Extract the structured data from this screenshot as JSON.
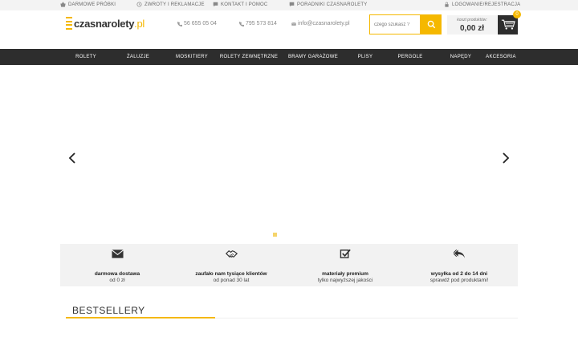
{
  "topbar": {
    "links": [
      "DARMOWE PRÓBKI",
      "ZWROTY I REKLAMACJE",
      "KONTAKT I POMOC",
      "PORADNIKI CZASNAROLETY"
    ],
    "login": "LOGOWANIE/REJESTRACJA"
  },
  "logo": {
    "brand": "czasnarolety",
    "tld": ".pl"
  },
  "contact": {
    "phone1": "56 655 05 04",
    "phone2": "795 573 814",
    "email": "info@czasnarolety.pl"
  },
  "search": {
    "placeholder": "czego szukasz ?"
  },
  "cart": {
    "label": "koszt produktów:",
    "total": "0,00 zł",
    "count": "0"
  },
  "nav": [
    "ROLETY",
    "ŻALUZJE",
    "MOSKITIERY",
    "ROLETY ZEWNĘTRZNE",
    "BRAMY GARAŻOWE",
    "PLISY",
    "PERGOLE",
    "NAPĘDY",
    "AKCESORIA"
  ],
  "features": [
    {
      "title": "darmowa dostawa",
      "subtitle": "od 0 zł",
      "icon": "envelope-icon"
    },
    {
      "title": "zaufało nam tysiące klientów",
      "subtitle": "od ponad 30 lat",
      "icon": "handshake-icon"
    },
    {
      "title": "materiały premium",
      "subtitle": "tylko najwyższej jakości",
      "icon": "checkbox-icon"
    },
    {
      "title": "wysyłka od 2 do 14 dni",
      "subtitle": "sprawdź pod produktami!",
      "icon": "reply-all-icon"
    }
  ],
  "bestsellers": {
    "title": "BESTSELLERY"
  },
  "colors": {
    "accent": "#f5b800",
    "nav_bg": "#2d2d2d",
    "panel_bg": "#f2f2f2"
  }
}
